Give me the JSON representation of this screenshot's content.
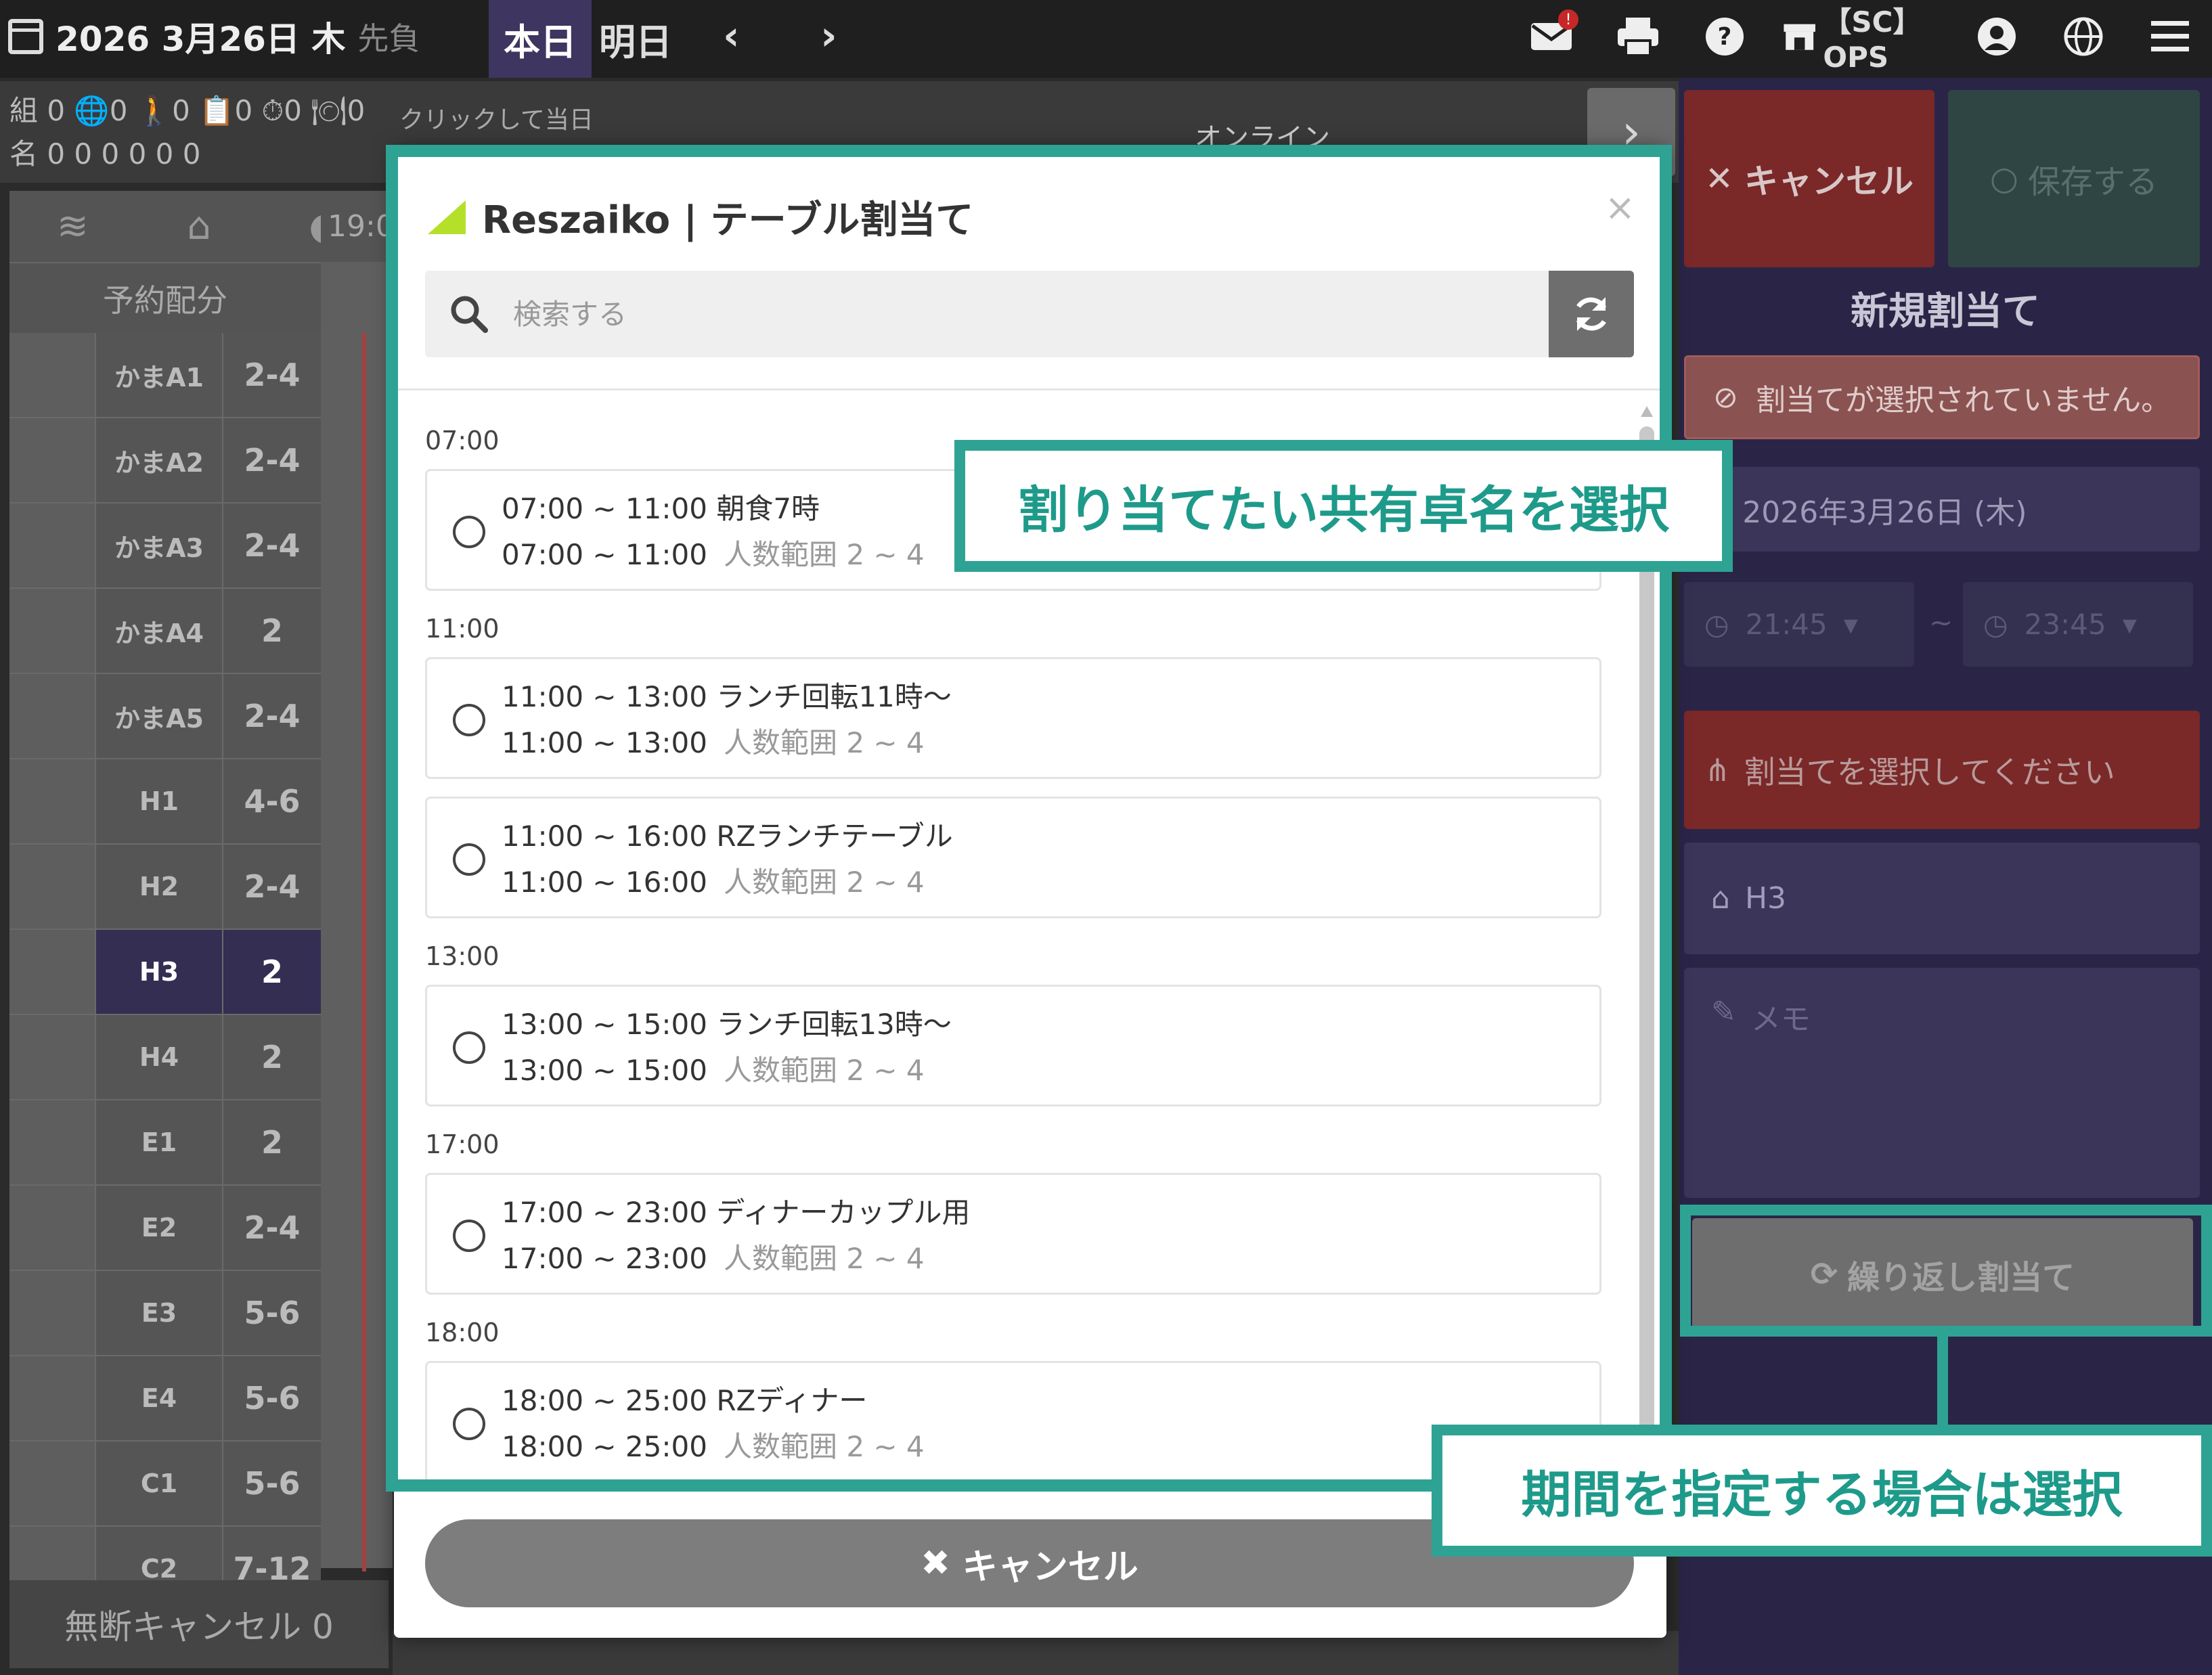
{
  "topbar": {
    "date": "2026 3月26日 木",
    "rokuyo": "先負",
    "today": "本日",
    "tomorrow": "明日",
    "prev": "‹",
    "next": "›",
    "ops": "【SC】OPS",
    "mail_badge": "!"
  },
  "counters": {
    "line1": "組 0  🌐0  🚶0  📋0  ⏱0  🍽0",
    "line2": "名 0     0     0     0     0     0"
  },
  "toolbar": {
    "click_label": "クリックして当日メモ",
    "online": "オンライン",
    "next": "›"
  },
  "grid": {
    "time_head": "19:0",
    "sub_header": "予約配分",
    "rows": [
      {
        "name": "かまA1",
        "cap": "2-4"
      },
      {
        "name": "かまA2",
        "cap": "2-4"
      },
      {
        "name": "かまA3",
        "cap": "2-4"
      },
      {
        "name": "かまA4",
        "cap": "2"
      },
      {
        "name": "かまA5",
        "cap": "2-4"
      },
      {
        "name": "H1",
        "cap": "4-6"
      },
      {
        "name": "H2",
        "cap": "2-4"
      },
      {
        "name": "H3",
        "cap": "2"
      },
      {
        "name": "H4",
        "cap": "2"
      },
      {
        "name": "E1",
        "cap": "2"
      },
      {
        "name": "E2",
        "cap": "2-4"
      },
      {
        "name": "E3",
        "cap": "5-6"
      },
      {
        "name": "E4",
        "cap": "5-6"
      },
      {
        "name": "C1",
        "cap": "5-6"
      },
      {
        "name": "C2",
        "cap": "7-12"
      }
    ],
    "selected_index": 7,
    "no_show": "無断キャンセル 0"
  },
  "right_panel": {
    "cancel": "キャンセル",
    "save": "保存する",
    "title": "新規割当て",
    "alert": "割当てが選択されていません。",
    "date": "2026年3月26日 (木)",
    "time_from": "21:45",
    "time_sep": "~",
    "time_to": "23:45",
    "select_prompt": "割当てを選択してください",
    "table": "H3",
    "memo": "メモ",
    "repeat": "繰り返し割当て"
  },
  "modal": {
    "title": "Reszaiko | テーブル割当て",
    "close": "×",
    "search_placeholder": "検索する",
    "cancel": "キャンセル",
    "groups": [
      {
        "time": "07:00",
        "items": [
          {
            "l1": "07:00 ~ 11:00 朝食7時",
            "l2_time": "07:00 ~ 11:00",
            "l2_range": "人数範囲 2 ~ 4"
          }
        ]
      },
      {
        "time": "11:00",
        "items": [
          {
            "l1": "11:00 ~ 13:00 ランチ回転11時〜",
            "l2_time": "11:00 ~ 13:00",
            "l2_range": "人数範囲 2 ~ 4"
          },
          {
            "l1": "11:00 ~ 16:00 RZランチテーブル",
            "l2_time": "11:00 ~ 16:00",
            "l2_range": "人数範囲 2 ~ 4"
          }
        ]
      },
      {
        "time": "13:00",
        "items": [
          {
            "l1": "13:00 ~ 15:00 ランチ回転13時〜",
            "l2_time": "13:00 ~ 15:00",
            "l2_range": "人数範囲 2 ~ 4"
          }
        ]
      },
      {
        "time": "17:00",
        "items": [
          {
            "l1": "17:00 ~ 23:00 ディナーカップル用",
            "l2_time": "17:00 ~ 23:00",
            "l2_range": "人数範囲 2 ~ 4"
          }
        ]
      },
      {
        "time": "18:00",
        "items": [
          {
            "l1": "18:00 ~ 25:00 RZディナー",
            "l2_time": "18:00 ~ 25:00",
            "l2_range": "人数範囲 2 ~ 4"
          }
        ]
      }
    ]
  },
  "annotations": {
    "callout_table": "割り当てたい共有卓名を選択",
    "callout_period": "期間を指定する場合は選択"
  },
  "colors": {
    "accent_teal": "#2ea394",
    "panel_purple": "#2a2547",
    "danger_red": "#7a2828",
    "logo_green": "#b5e02a"
  }
}
